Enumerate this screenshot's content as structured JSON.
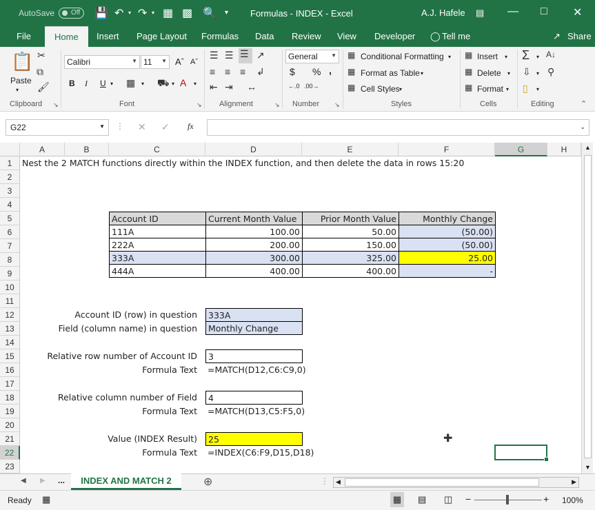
{
  "titlebar": {
    "autosave_label": "AutoSave",
    "autosave_state": "Off",
    "title": "Formulas - INDEX  -  Excel",
    "user": "A.J. Hafele"
  },
  "tabs": [
    "File",
    "Home",
    "Insert",
    "Page Layout",
    "Formulas",
    "Data",
    "Review",
    "View",
    "Developer"
  ],
  "active_tab": "Home",
  "tell_me": "Tell me",
  "share": "Share",
  "ribbon": {
    "clipboard": {
      "label": "Clipboard",
      "paste": "Paste"
    },
    "font": {
      "label": "Font",
      "name": "Calibri",
      "size": "11",
      "bold": "B",
      "italic": "I",
      "underline": "U"
    },
    "alignment": {
      "label": "Alignment"
    },
    "number": {
      "label": "Number",
      "format": "General",
      "currency": "$",
      "percent": "%",
      "comma": ","
    },
    "styles": {
      "label": "Styles",
      "conditional": "Conditional Formatting",
      "table": "Format as Table",
      "cell_styles": "Cell Styles"
    },
    "cells": {
      "label": "Cells",
      "insert": "Insert",
      "delete": "Delete",
      "format": "Format"
    },
    "editing": {
      "label": "Editing"
    }
  },
  "formula_bar": {
    "name_box": "G22",
    "formula": "",
    "fx": "fx"
  },
  "columns": [
    "A",
    "B",
    "C",
    "D",
    "E",
    "F",
    "G",
    "H"
  ],
  "selected_column": "G",
  "rows": [
    "1",
    "2",
    "3",
    "4",
    "5",
    "6",
    "7",
    "8",
    "9",
    "10",
    "11",
    "12",
    "13",
    "14",
    "15",
    "16",
    "17",
    "18",
    "19",
    "20",
    "21",
    "22",
    "23"
  ],
  "selected_row": "22",
  "cells": {
    "a1": "Nest the 2 MATCH functions directly within the INDEX function, and then delete the data in rows 15:20",
    "table_headers": [
      "Account ID",
      "Current Month Value",
      "Prior Month Value",
      "Monthly Change"
    ],
    "table_rows": [
      [
        "111A",
        "100.00",
        "50.00",
        "(50.00)"
      ],
      [
        "222A",
        "200.00",
        "150.00",
        "(50.00)"
      ],
      [
        "333A",
        "300.00",
        "325.00",
        "25.00"
      ],
      [
        "444A",
        "400.00",
        "400.00",
        "-"
      ]
    ],
    "c12": "Account ID (row) in question",
    "d12": "333A",
    "c13": "Field (column name) in question",
    "d13": "Monthly Change",
    "c15": "Relative row number of Account ID",
    "d15": "3",
    "c16": "Formula Text",
    "d16": "=MATCH(D12,C6:C9,0)",
    "c18": "Relative column number of Field",
    "d18": "4",
    "c19": "Formula Text",
    "d19": "=MATCH(D13,C5:F5,0)",
    "c21": "Value (INDEX Result)",
    "d21": "25",
    "c22": "Formula Text",
    "d22": "=INDEX(C6:F9,D15,D18)"
  },
  "sheet_tab": "INDEX AND MATCH 2",
  "sheet_ellipsis": "...",
  "status": {
    "ready": "Ready",
    "zoom": "100%"
  },
  "colors": {
    "accent": "#217346",
    "highlight": "#ffff00",
    "input_fill": "#d9e1f2"
  }
}
